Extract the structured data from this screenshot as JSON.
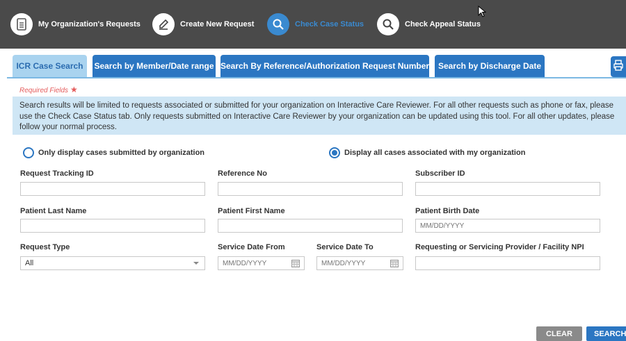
{
  "nav": {
    "items": [
      {
        "label": "My Organization's Requests",
        "icon": "document-icon"
      },
      {
        "label": "Create New Request",
        "icon": "pencil-icon"
      },
      {
        "label": "Check Case Status",
        "icon": "search-icon",
        "active": true
      },
      {
        "label": "Check Appeal Status",
        "icon": "search-icon"
      }
    ]
  },
  "tabs": [
    {
      "label": "ICR Case Search",
      "active": true
    },
    {
      "label": "Search by Member/Date range"
    },
    {
      "label": "Search By Reference/Authorization Request Number"
    },
    {
      "label": "Search by Discharge Date"
    }
  ],
  "form": {
    "required_label": "Required Fields",
    "required_star": "★",
    "info_text": "Search results will be limited to requests associated or submitted for your organization on Interactive Care Reviewer. For all other requests such as phone or fax, please use the Check Case Status tab. Only requests submitted on Interactive Care Reviewer by your organization can be updated using this tool. For all other updates, please follow your normal process.",
    "radio_org_only": "Only display cases submitted by organization",
    "radio_all": "Display all cases associated with my organization",
    "radio_selected": "all",
    "fields": {
      "request_tracking_id": {
        "label": "Request Tracking ID",
        "value": ""
      },
      "reference_no": {
        "label": "Reference No",
        "value": ""
      },
      "subscriber_id": {
        "label": "Subscriber ID",
        "value": ""
      },
      "patient_last_name": {
        "label": "Patient Last Name",
        "value": ""
      },
      "patient_first_name": {
        "label": "Patient First Name",
        "value": ""
      },
      "patient_birth_date": {
        "label": "Patient Birth Date",
        "placeholder": "MM/DD/YYYY"
      },
      "request_type": {
        "label": "Request Type",
        "value": "All"
      },
      "service_date_from": {
        "label": "Service Date From",
        "placeholder": "MM/DD/YYYY"
      },
      "service_date_to": {
        "label": "Service Date To",
        "placeholder": "MM/DD/YYYY"
      },
      "provider_npi": {
        "label": "Requesting or Servicing Provider / Facility NPI",
        "value": ""
      }
    }
  },
  "buttons": {
    "clear": "CLEAR",
    "search": "SEARCH"
  },
  "colors": {
    "nav_bg": "#4a4a4a",
    "accent": "#2b76c2",
    "active_tab": "#a9d3ef",
    "info_bg": "#cfe6f5",
    "required": "#e45b5b"
  }
}
